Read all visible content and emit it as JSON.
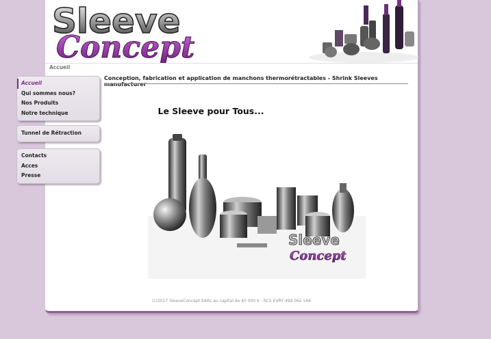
{
  "header": {
    "logo_text_1": "Sleeve",
    "logo_text_2": "Concept",
    "breadcrumb": "Accueil"
  },
  "colors": {
    "accent": "#7a2e88",
    "background": "#d9c7dc"
  },
  "nav": {
    "group1": [
      {
        "label": "Accueil",
        "active": true
      },
      {
        "label": "Qui sommes nous?"
      },
      {
        "label": "Nos Produits"
      },
      {
        "label": "Notre technique"
      }
    ],
    "group2": [
      {
        "label": "Tunnel de Rétraction"
      }
    ],
    "group3": [
      {
        "label": "Contacts"
      },
      {
        "label": "Acces"
      },
      {
        "label": "Presse"
      }
    ]
  },
  "main": {
    "tagline": "Conception, fabrication et application de manchons thermorétractables - Shrink Sleeves manufacturer",
    "title": "Le Sleeve pour Tous...",
    "image_logo_1": "Sleeve",
    "image_logo_2": "Concept"
  },
  "footer": {
    "text": "(c)2017 SleeveConcept SARL au capital de 40 000 € - RCS EVRY 499 062 594"
  }
}
